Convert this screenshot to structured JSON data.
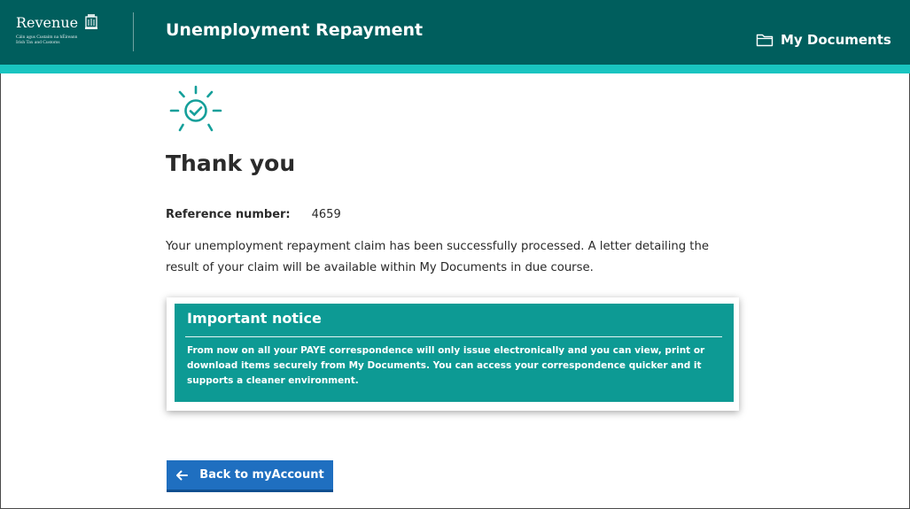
{
  "header": {
    "logo": {
      "wordmark": "Revenue",
      "subtitle_line1": "Cáin agus Custaim na hÉireann",
      "subtitle_line2": "Irish Tax and Customs"
    },
    "app_title": "Unemployment Repayment",
    "my_documents_label": "My Documents"
  },
  "main": {
    "heading": "Thank you",
    "reference_label": "Reference number:",
    "reference_value": "4659",
    "message": "Your unemployment repayment claim has been successfully processed. A letter detailing the result of your claim will be available within My Documents in due course."
  },
  "notice": {
    "title": "Important notice",
    "body": "From now on all your PAYE correspondence will only issue electronically and you can view, print or download items securely from My Documents. You can access your correspondence quicker and it supports a cleaner environment."
  },
  "actions": {
    "back_label": "Back to myAccount"
  },
  "colors": {
    "header_bg": "#005e5d",
    "header_stripe": "#19c4c0",
    "notice_bg": "#0d9a94",
    "button_bg": "#1f6fc0",
    "success_icon": "#149f9a"
  },
  "icons": {
    "logo_crest": "harp-crest-icon",
    "my_documents": "folder-icon",
    "success": "sun-check-icon",
    "back": "arrow-left-icon"
  }
}
